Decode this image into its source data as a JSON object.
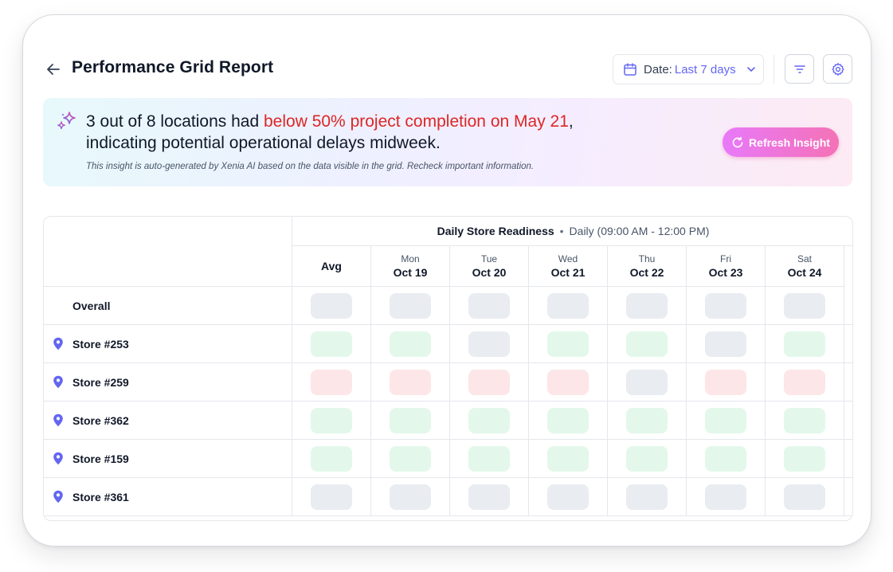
{
  "header": {
    "title": "Performance Grid Report",
    "date_label": "Date:",
    "date_value": "Last 7 days"
  },
  "insight": {
    "prefix": "3 out of 8 locations had ",
    "highlight": "below 50% project completion on May 21",
    "suffix": ",",
    "line2": "indicating potential operational delays midweek.",
    "note": "This insight is auto-generated by Xenia AI based on the data visible in the grid. Recheck important information.",
    "refresh_label": "Refresh Insight"
  },
  "grid": {
    "group_title": "Daily Store Readiness",
    "group_sep": "•",
    "group_subtitle": "Daily (09:00 AM - 12:00 PM)",
    "avg_label": "Avg",
    "columns": [
      {
        "day": "Mon",
        "date": "Oct 19"
      },
      {
        "day": "Tue",
        "date": "Oct 20"
      },
      {
        "day": "Wed",
        "date": "Oct 21"
      },
      {
        "day": "Thu",
        "date": "Oct 22"
      },
      {
        "day": "Fri",
        "date": "Oct 23"
      },
      {
        "day": "Sat",
        "date": "Oct 24"
      }
    ],
    "rows": [
      {
        "label": "Overall",
        "statuses": [
          "gray",
          "gray",
          "gray",
          "gray",
          "gray",
          "gray",
          "gray"
        ]
      },
      {
        "label": "Store #253",
        "statuses": [
          "green",
          "green",
          "gray",
          "green",
          "green",
          "gray",
          "green"
        ]
      },
      {
        "label": "Store #259",
        "statuses": [
          "red",
          "red",
          "red",
          "red",
          "gray",
          "red",
          "red"
        ]
      },
      {
        "label": "Store #362",
        "statuses": [
          "green",
          "green",
          "green",
          "green",
          "green",
          "green",
          "green"
        ]
      },
      {
        "label": "Store #159",
        "statuses": [
          "green",
          "green",
          "green",
          "green",
          "green",
          "green",
          "green"
        ]
      },
      {
        "label": "Store #361",
        "statuses": [
          "gray",
          "gray",
          "gray",
          "gray",
          "gray",
          "gray",
          "gray"
        ]
      }
    ]
  },
  "colors": {
    "accent": "#6366f1",
    "highlight_red": "#dc2626",
    "status_green": "#e3f8ea",
    "status_red": "#fde6e8",
    "status_gray": "#e9ecf0"
  },
  "icons": [
    "back-arrow-icon",
    "calendar-icon",
    "chevron-down-icon",
    "filter-icon",
    "settings-icon",
    "sparkle-icon",
    "refresh-icon",
    "location-pin-icon"
  ]
}
